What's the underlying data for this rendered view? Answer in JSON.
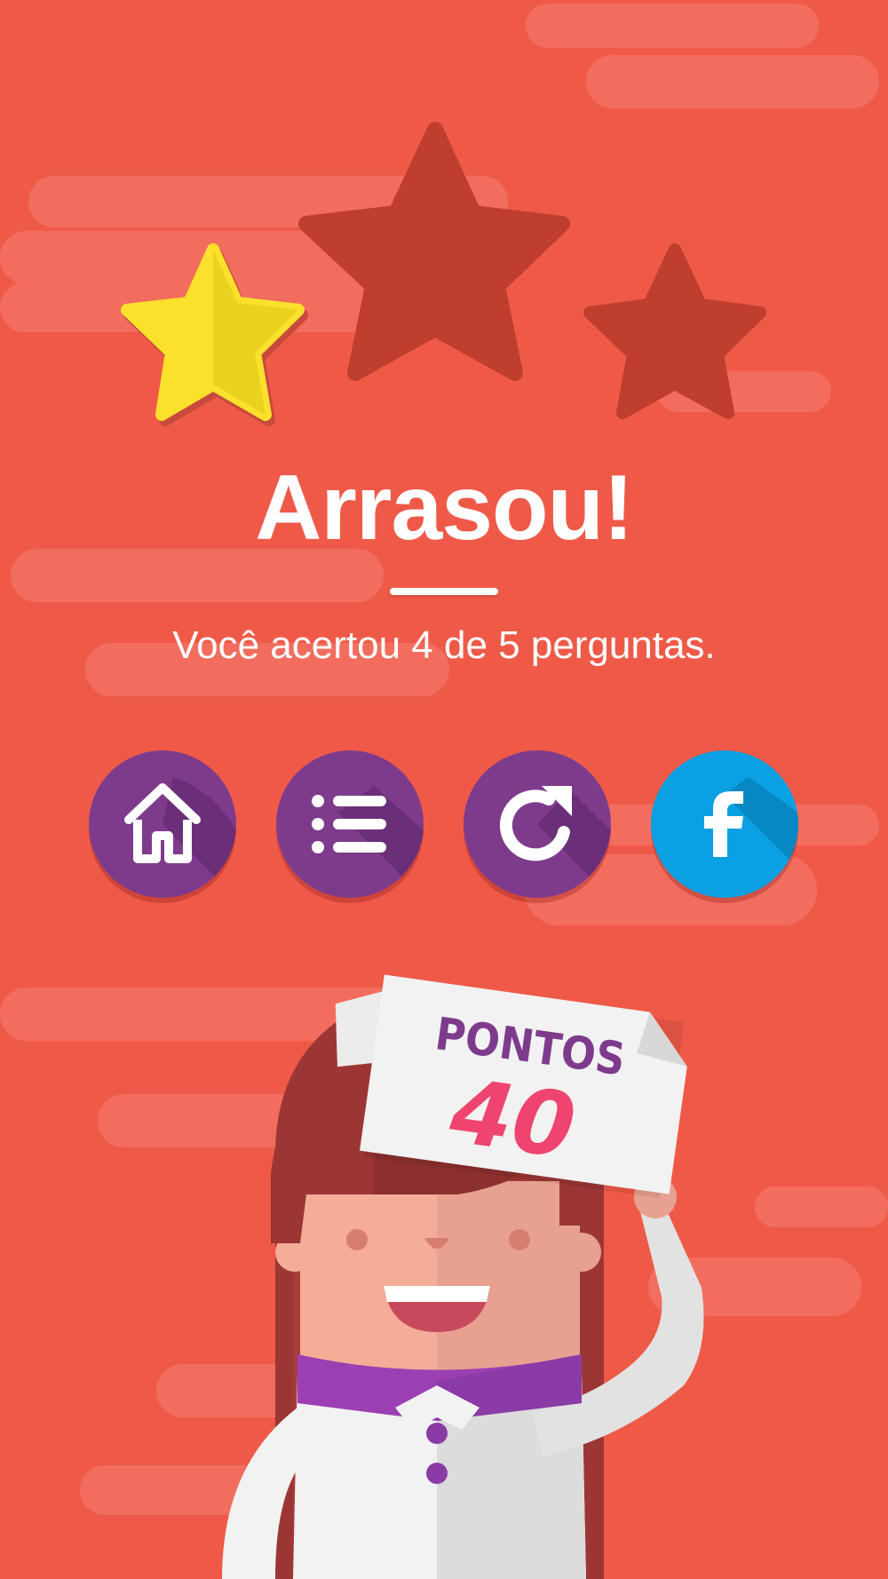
{
  "result": {
    "headline": "Arrasou!",
    "message": "Você acertou 4 de 5 perguntas.",
    "stars_earned": 1,
    "stars_total": 3
  },
  "actions": {
    "home_icon": "home-icon",
    "list_icon": "list-icon",
    "retry_icon": "refresh-icon",
    "share_icon": "facebook-icon"
  },
  "score_sign": {
    "label": "PONTOS",
    "score": "40"
  },
  "colors": {
    "background": "#ef5a48",
    "star_earned": "#fbe02c",
    "star_empty": "#bf3e2d",
    "button_purple": "#7e3b8c",
    "button_facebook": "#0aa0e2",
    "score_color": "#ef4470",
    "label_color": "#7e3b8c"
  }
}
